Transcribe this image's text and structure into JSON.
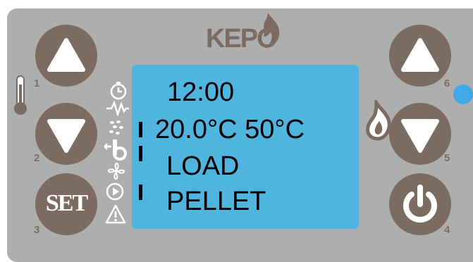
{
  "brand": {
    "name": "KEPO",
    "logo_text": "KEPÓ",
    "color": "#7c6b61"
  },
  "display": {
    "line1": "12:00",
    "line2": "20.0°C 50°C",
    "line3": "LOAD",
    "line4": "PELLET",
    "background": "#4fb4de"
  },
  "buttons": {
    "b1": {
      "number": "1",
      "icon": "triangle-up-icon"
    },
    "b2": {
      "number": "2",
      "icon": "triangle-down-icon"
    },
    "b3": {
      "number": "3",
      "label": "SET"
    },
    "b4": {
      "number": "4",
      "icon": "power-icon"
    },
    "b5": {
      "number": "5",
      "icon": "triangle-down-icon"
    },
    "b6": {
      "number": "6",
      "icon": "triangle-up-icon"
    }
  },
  "status_icons": [
    "clock-icon",
    "zigzag-icon",
    "pellet-icon",
    "pump-icon",
    "fan-icon",
    "play-icon",
    "warning-icon"
  ],
  "indicator_led": {
    "color": "#3fa8e5"
  }
}
